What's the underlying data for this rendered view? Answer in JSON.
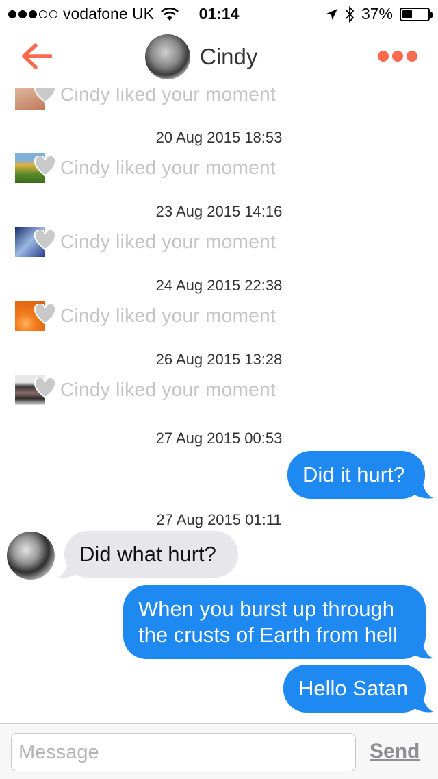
{
  "status_bar": {
    "carrier": "vodafone UK",
    "time": "01:14",
    "battery": "37%",
    "battery_level": 0.37,
    "signal_bars": 3
  },
  "header": {
    "title": "Cindy",
    "accent_color": "#fe6a4f"
  },
  "likes": [
    {
      "text": "Cindy liked your moment",
      "thumb_colors": [
        "#e8c8b0",
        "#c07a5a"
      ]
    },
    {
      "text": "Cindy liked your moment",
      "thumb_colors": [
        "#7fb0d8",
        "#5a8a2a"
      ]
    },
    {
      "text": "Cindy liked your moment",
      "thumb_colors": [
        "#2a3a8a",
        "#9ab8e0"
      ]
    },
    {
      "text": "Cindy liked your moment",
      "thumb_colors": [
        "#f27a1a",
        "#d85a10"
      ]
    },
    {
      "text": "Cindy liked your moment",
      "thumb_colors": [
        "#e8e8e8",
        "#2a2a2a"
      ]
    }
  ],
  "timestamps": [
    "20 Aug 2015 18:53",
    "23 Aug 2015 14:16",
    "24 Aug 2015 22:38",
    "26 Aug 2015 13:28",
    "27 Aug 2015 00:53",
    "27 Aug 2015 01:11"
  ],
  "messages": {
    "m1": "Did it hurt?",
    "m2": "Did what hurt?",
    "m3_line1": "When you burst up through",
    "m3_line2": "the crusts of Earth from hell",
    "m4": "Hello Satan"
  },
  "composer": {
    "placeholder": "Message",
    "send_label": "Send"
  },
  "colors": {
    "outgoing": "#1e89f0",
    "incoming": "#e6e6eb",
    "like_text": "#c4c4c4"
  }
}
